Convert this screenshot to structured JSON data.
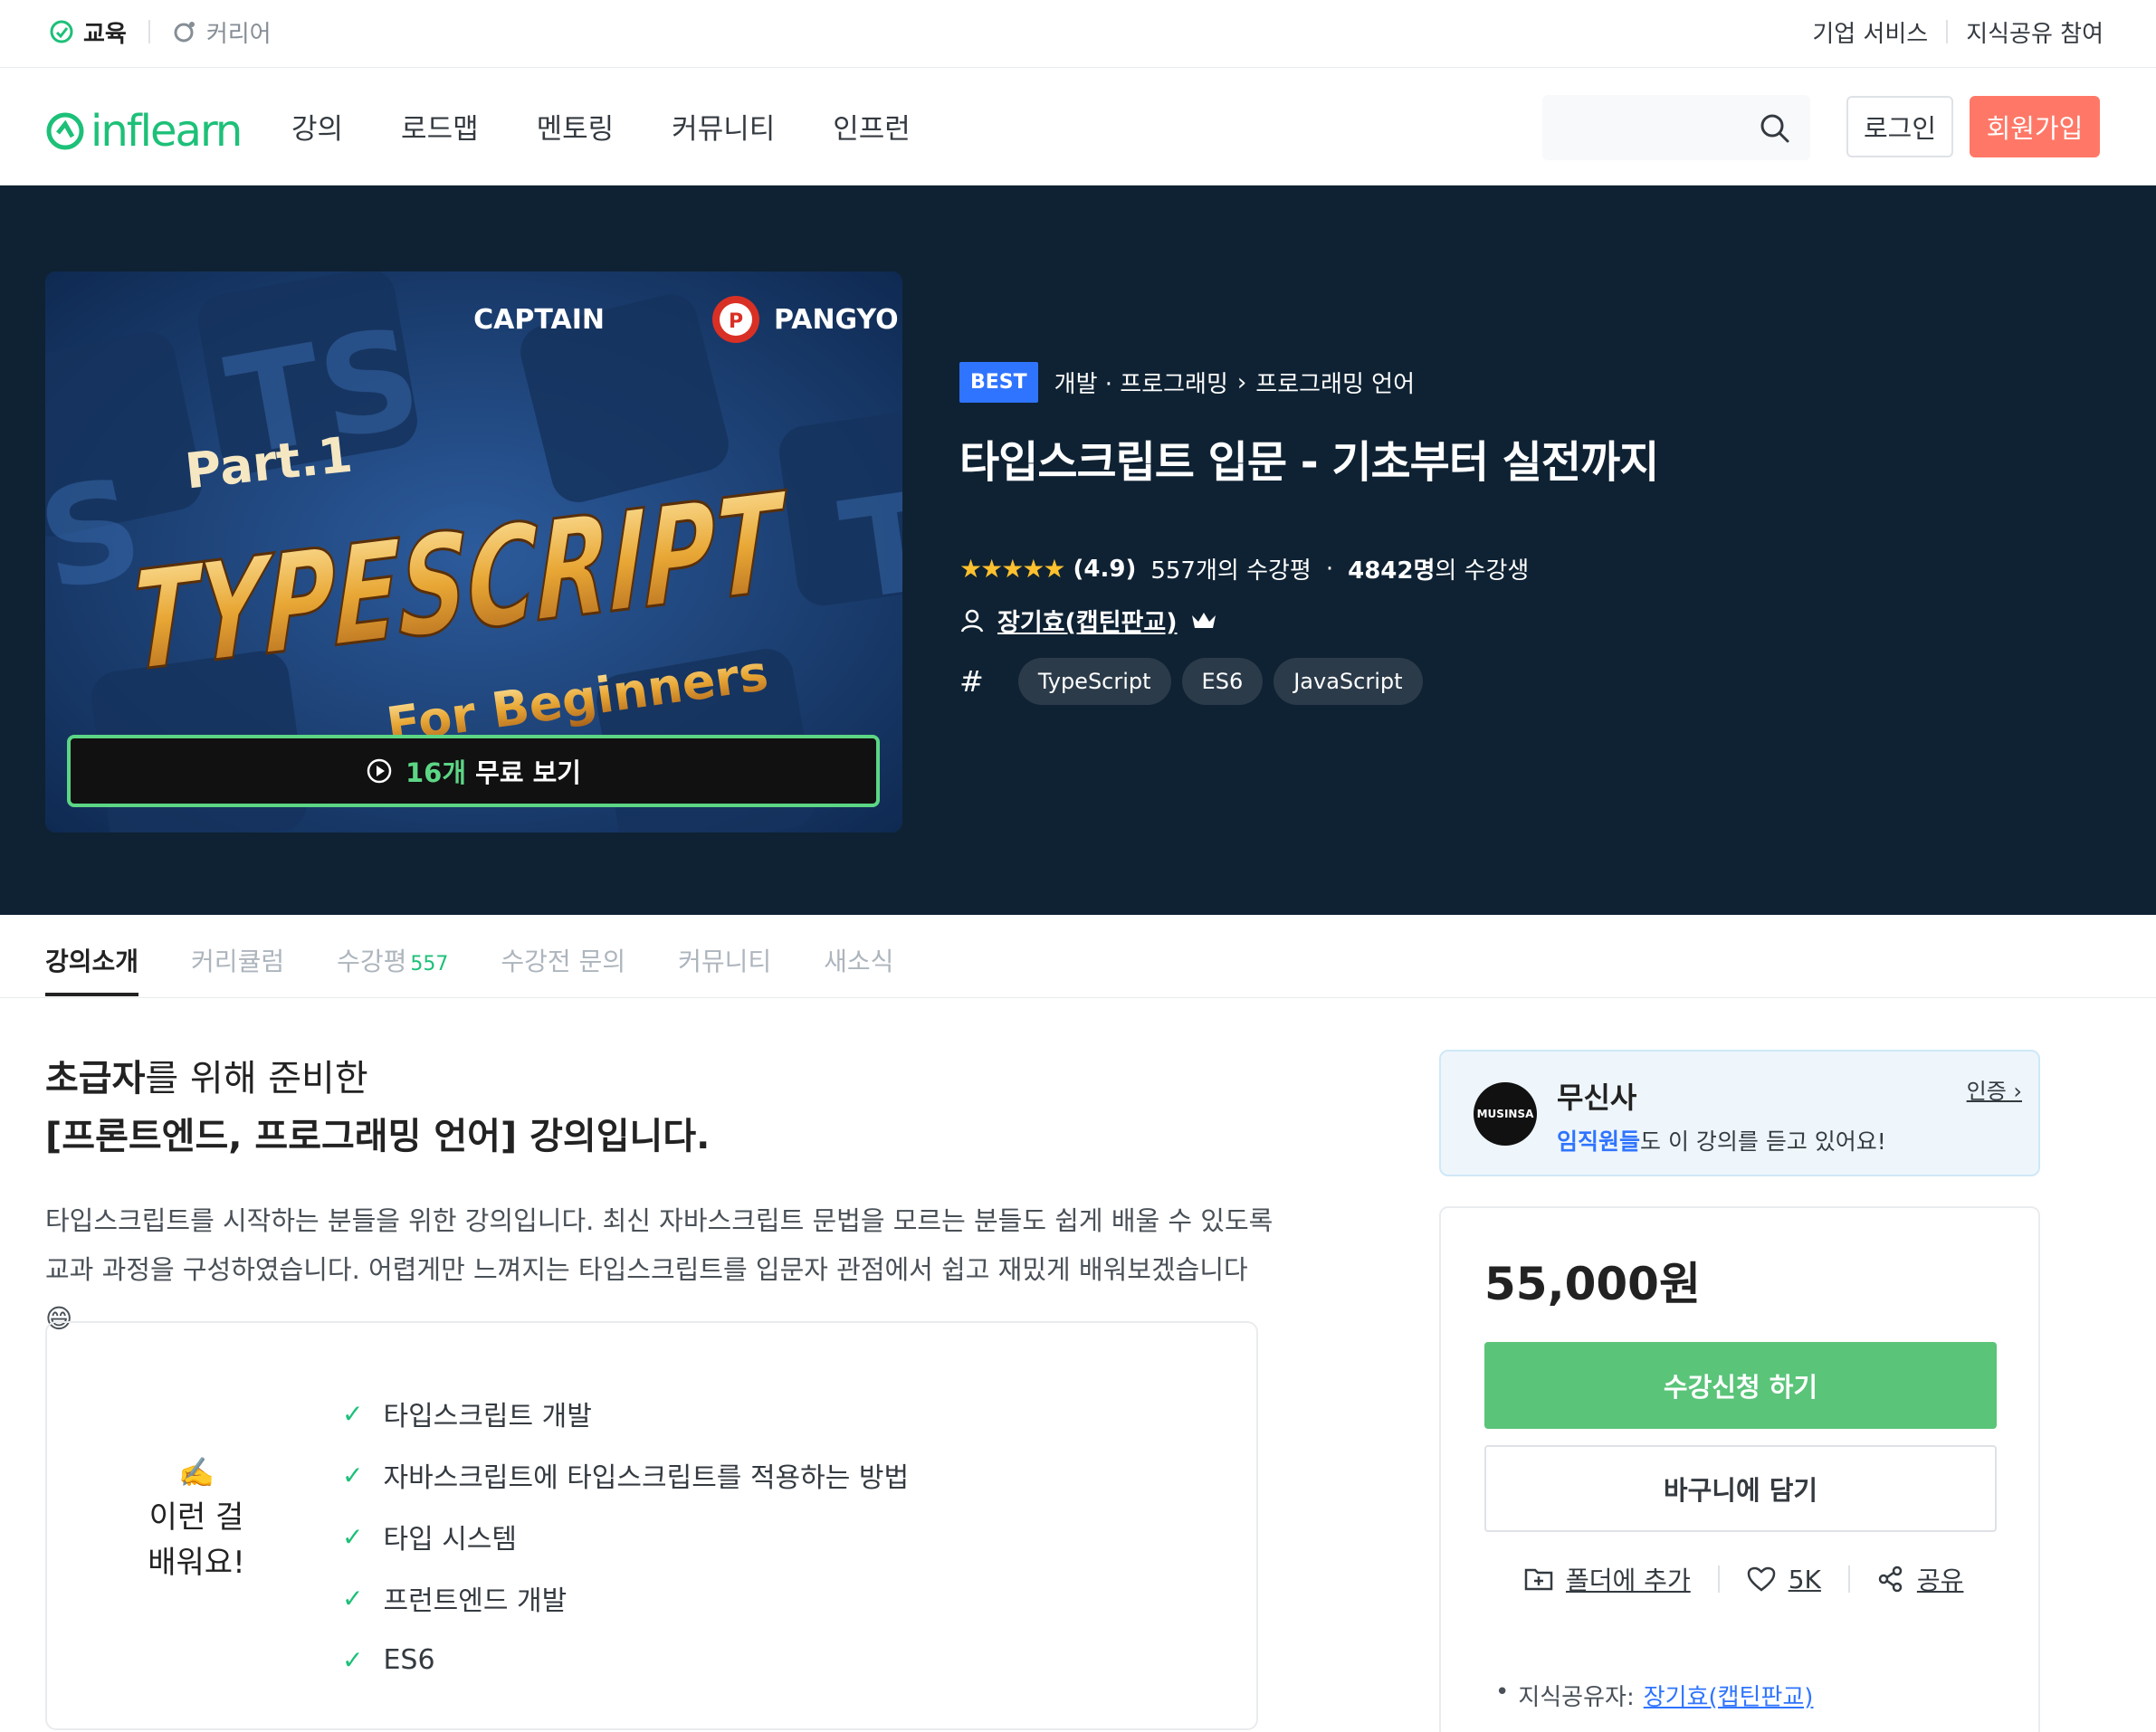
{
  "utilbar": {
    "edu_label": "교육",
    "career_label": "커리어",
    "biz_label": "기업 서비스",
    "share_label": "지식공유 참여"
  },
  "nav": {
    "logo_text": "inflearn",
    "menu": [
      "강의",
      "로드맵",
      "멘토링",
      "커뮤니티",
      "인프런"
    ],
    "search_placeholder": "",
    "login_label": "로그인",
    "signup_label": "회원가입"
  },
  "hero": {
    "thumbnail": {
      "brand": "CAPTAIN",
      "brand2": "PANGYO",
      "part": "Part.1",
      "title": "TYPESCRIPT",
      "subtitle": "For Beginners"
    },
    "free_preview": {
      "count": "16개",
      "label": "무료 보기"
    },
    "badge": "BEST",
    "category": "개발 · 프로그래밍",
    "subcategory": "프로그래밍 언어",
    "title": "타입스크립트 입문 - 기초부터 실전까지",
    "stars": "★★★★★",
    "rating": "(4.9)",
    "reviews_text": "557개의 수강평",
    "students_count": "4842명",
    "students_suffix": "의 수강생",
    "author": "장기효(캡틴판교)",
    "tags": [
      "TypeScript",
      "ES6",
      "JavaScript"
    ]
  },
  "tabs": [
    {
      "label": "강의소개",
      "count": ""
    },
    {
      "label": "커리큘럼",
      "count": ""
    },
    {
      "label": "수강평",
      "count": "557"
    },
    {
      "label": "수강전 문의",
      "count": ""
    },
    {
      "label": "커뮤니티",
      "count": ""
    },
    {
      "label": "새소식",
      "count": ""
    }
  ],
  "intro": {
    "head1_bold": "초급자",
    "head1_rest": "를 위해 준비한",
    "head2": "[프론트엔드, 프로그래밍 언어] 강의입니다.",
    "desc1": "타입스크립트를 시작하는 분들을 위한 강의입니다. 최신 자바스크립트 문법을 모르는 분들도 쉽게 배울 수 있도록",
    "desc2": "교과 과정을 구성하였습니다. 어렵게만 느껴지는 타입스크립트를 입문자 관점에서 쉽고 재밌게 배워보겠습니다 😄",
    "learn_icon": "✍️",
    "learn_label1": "이런 걸",
    "learn_label2": "배워요!",
    "learn_items": [
      "타입스크립트 개발",
      "자바스크립트에 타입스크립트를 적용하는 방법",
      "타입 시스템",
      "프런트엔드 개발",
      "ES6"
    ]
  },
  "company": {
    "logo": "MUSINSA",
    "name": "무신사",
    "text_bold": "임직원들",
    "text_rest": "도 이 강의를 듣고 있어요!",
    "cert_label": "인증 ›"
  },
  "purchase": {
    "price": "55,000원",
    "enroll_label": "수강신청 하기",
    "cart_label": "바구니에 담기",
    "folder_label": "폴더에 추가",
    "like_count": "5K",
    "share_label": "공유",
    "sharer_prefix": "지식공유자:",
    "sharer_name": "장기효(캡틴판교)"
  },
  "colors": {
    "accent": "#1dc078",
    "signup": "#ff7867",
    "hero_bg": "#0f2233",
    "best": "#2f74ff",
    "star": "#fdc02e",
    "enroll": "#5ac479"
  }
}
